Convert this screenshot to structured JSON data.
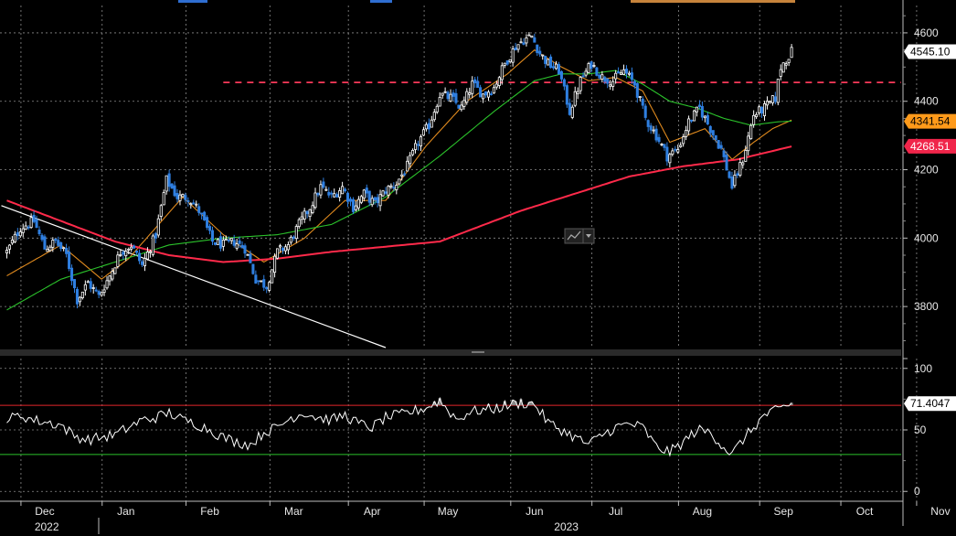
{
  "chart_data": [
    {
      "type": "candlestick",
      "panel": "price",
      "ylim": [
        3680,
        4680
      ],
      "yticks": [
        3800,
        4000,
        4200,
        4400,
        4600
      ],
      "grid": true,
      "legend": "none",
      "last_price": 4545.1,
      "last_price_label": "4545.10",
      "ma50_last": 4341.54,
      "ma50_label": "4341.54",
      "ma200_last": 4268.51,
      "ma200_label": "4268.51",
      "resistance_level": 4455,
      "colors": {
        "up": "#ffffff",
        "down": "#2f7fe0",
        "ma20": "#e08a1e",
        "ma50": "#2bc22b",
        "ma200": "#ff2a4a",
        "resistance": "#ff3a5a",
        "trendline": "#ffffff",
        "grid": "#8c8c8c",
        "badge_default": "#ffffff",
        "badge_orange": "#ff9a1a",
        "badge_red": "#f0254a"
      },
      "close_anchors": [
        [
          0,
          3960
        ],
        [
          5,
          4030
        ],
        [
          10,
          4050
        ],
        [
          14,
          3970
        ],
        [
          18,
          3990
        ],
        [
          22,
          3950
        ],
        [
          26,
          3820
        ],
        [
          30,
          3870
        ],
        [
          34,
          3830
        ],
        [
          38,
          3890
        ],
        [
          42,
          3960
        ],
        [
          46,
          3980
        ],
        [
          50,
          3920
        ],
        [
          55,
          4010
        ],
        [
          59,
          4170
        ],
        [
          63,
          4120
        ],
        [
          67,
          4120
        ],
        [
          71,
          4080
        ],
        [
          76,
          3990
        ],
        [
          80,
          3980
        ],
        [
          84,
          3990
        ],
        [
          88,
          3970
        ],
        [
          92,
          3880
        ],
        [
          96,
          3860
        ],
        [
          100,
          3960
        ],
        [
          104,
          3980
        ],
        [
          108,
          4040
        ],
        [
          112,
          4090
        ],
        [
          116,
          4150
        ],
        [
          120,
          4120
        ],
        [
          124,
          4150
        ],
        [
          128,
          4090
        ],
        [
          132,
          4130
        ],
        [
          136,
          4100
        ],
        [
          140,
          4140
        ],
        [
          144,
          4160
        ],
        [
          148,
          4210
        ],
        [
          152,
          4280
        ],
        [
          156,
          4330
        ],
        [
          160,
          4420
        ],
        [
          164,
          4410
        ],
        [
          168,
          4380
        ],
        [
          172,
          4450
        ],
        [
          176,
          4420
        ],
        [
          180,
          4440
        ],
        [
          184,
          4510
        ],
        [
          188,
          4560
        ],
        [
          191,
          4580
        ],
        [
          194,
          4590
        ],
        [
          197,
          4540
        ],
        [
          200,
          4510
        ],
        [
          204,
          4490
        ],
        [
          208,
          4370
        ],
        [
          212,
          4460
        ],
        [
          216,
          4510
        ],
        [
          220,
          4470
        ],
        [
          224,
          4460
        ],
        [
          228,
          4490
        ],
        [
          232,
          4450
        ],
        [
          236,
          4350
        ],
        [
          240,
          4300
        ],
        [
          244,
          4240
        ],
        [
          248,
          4260
        ],
        [
          252,
          4340
        ],
        [
          256,
          4380
        ],
        [
          260,
          4320
        ],
        [
          264,
          4260
        ],
        [
          268,
          4150
        ],
        [
          272,
          4230
        ],
        [
          276,
          4360
        ],
        [
          280,
          4380
        ],
        [
          284,
          4410
        ],
        [
          286,
          4500
        ],
        [
          290,
          4545
        ]
      ],
      "series": [
        {
          "name": "",
          "anchors": [
            [
              0,
              3890
            ],
            [
              20,
              3980
            ],
            [
              35,
              3880
            ],
            [
              45,
              3940
            ],
            [
              65,
              4120
            ],
            [
              80,
              4010
            ],
            [
              95,
              3930
            ],
            [
              110,
              4000
            ],
            [
              125,
              4110
            ],
            [
              140,
              4110
            ],
            [
              155,
              4270
            ],
            [
              170,
              4400
            ],
            [
              185,
              4480
            ],
            [
              195,
              4550
            ],
            [
              205,
              4500
            ],
            [
              215,
              4460
            ],
            [
              225,
              4470
            ],
            [
              235,
              4430
            ],
            [
              245,
              4280
            ],
            [
              258,
              4320
            ],
            [
              268,
              4230
            ],
            [
              276,
              4280
            ],
            [
              283,
              4320
            ],
            [
              290,
              4345
            ]
          ]
        },
        {
          "name": "",
          "anchors": [
            [
              0,
              3790
            ],
            [
              20,
              3880
            ],
            [
              40,
              3930
            ],
            [
              60,
              3980
            ],
            [
              80,
              4000
            ],
            [
              100,
              4010
            ],
            [
              120,
              4040
            ],
            [
              140,
              4120
            ],
            [
              160,
              4240
            ],
            [
              180,
              4370
            ],
            [
              195,
              4460
            ],
            [
              205,
              4480
            ],
            [
              215,
              4480
            ],
            [
              225,
              4490
            ],
            [
              235,
              4450
            ],
            [
              245,
              4400
            ],
            [
              255,
              4380
            ],
            [
              265,
              4350
            ],
            [
              275,
              4330
            ],
            [
              285,
              4340
            ],
            [
              290,
              4342
            ]
          ]
        },
        {
          "name": "",
          "anchors": [
            [
              0,
              4110
            ],
            [
              20,
              4050
            ],
            [
              40,
              3990
            ],
            [
              60,
              3950
            ],
            [
              80,
              3930
            ],
            [
              100,
              3940
            ],
            [
              120,
              3960
            ],
            [
              140,
              3975
            ],
            [
              160,
              3990
            ],
            [
              170,
              4020
            ],
            [
              190,
              4080
            ],
            [
              210,
              4130
            ],
            [
              230,
              4180
            ],
            [
              250,
              4210
            ],
            [
              270,
              4230
            ],
            [
              290,
              4268
            ]
          ]
        }
      ],
      "trendline": [
        [
          0,
          4095
        ],
        [
          140,
          3680
        ]
      ]
    },
    {
      "type": "line",
      "panel": "indicator",
      "ylim": [
        -8,
        108
      ],
      "yticks": [
        0,
        50,
        100
      ],
      "upper_band": 70,
      "lower_band": 30,
      "last_value": 71.4047,
      "last_value_label": "71.4047",
      "colors": {
        "line": "#ffffff",
        "upper_band": "#e2252b",
        "lower_band": "#2bc22b",
        "grid": "#8c8c8c"
      },
      "anchors": [
        [
          0,
          58
        ],
        [
          5,
          62
        ],
        [
          10,
          58
        ],
        [
          15,
          56
        ],
        [
          20,
          54
        ],
        [
          25,
          45
        ],
        [
          30,
          42
        ],
        [
          35,
          44
        ],
        [
          40,
          46
        ],
        [
          45,
          52
        ],
        [
          50,
          58
        ],
        [
          55,
          60
        ],
        [
          60,
          64
        ],
        [
          65,
          58
        ],
        [
          70,
          55
        ],
        [
          75,
          50
        ],
        [
          80,
          44
        ],
        [
          85,
          40
        ],
        [
          90,
          38
        ],
        [
          95,
          48
        ],
        [
          100,
          52
        ],
        [
          105,
          60
        ],
        [
          110,
          64
        ],
        [
          115,
          60
        ],
        [
          120,
          58
        ],
        [
          125,
          62
        ],
        [
          130,
          55
        ],
        [
          135,
          52
        ],
        [
          140,
          60
        ],
        [
          145,
          62
        ],
        [
          150,
          65
        ],
        [
          155,
          68
        ],
        [
          160,
          74
        ],
        [
          163,
          66
        ],
        [
          167,
          58
        ],
        [
          170,
          64
        ],
        [
          175,
          66
        ],
        [
          180,
          67
        ],
        [
          185,
          70
        ],
        [
          190,
          72
        ],
        [
          195,
          71
        ],
        [
          200,
          56
        ],
        [
          205,
          50
        ],
        [
          210,
          44
        ],
        [
          215,
          38
        ],
        [
          220,
          46
        ],
        [
          225,
          52
        ],
        [
          230,
          55
        ],
        [
          235,
          52
        ],
        [
          240,
          36
        ],
        [
          245,
          32
        ],
        [
          250,
          40
        ],
        [
          255,
          50
        ],
        [
          260,
          48
        ],
        [
          265,
          36
        ],
        [
          268,
          30
        ],
        [
          272,
          42
        ],
        [
          276,
          52
        ],
        [
          280,
          62
        ],
        [
          285,
          66
        ],
        [
          290,
          71.4
        ]
      ]
    }
  ],
  "x_axis": {
    "months": [
      {
        "label": "Dec",
        "bar": 14
      },
      {
        "label": "Jan",
        "bar": 44
      },
      {
        "label": "Feb",
        "bar": 75
      },
      {
        "label": "Mar",
        "bar": 106
      },
      {
        "label": "Apr",
        "bar": 135
      },
      {
        "label": "May",
        "bar": 163
      },
      {
        "label": "Jun",
        "bar": 195
      },
      {
        "label": "Jul",
        "bar": 225
      },
      {
        "label": "Aug",
        "bar": 257
      },
      {
        "label": "Sep",
        "bar": 287
      },
      {
        "label": "Oct",
        "bar": 317
      },
      {
        "label": "Nov",
        "bar": 345
      }
    ],
    "years": [
      {
        "label": "2022",
        "bar": 8
      },
      {
        "label": "2023",
        "bar": 200
      }
    ],
    "bars_total": 291
  }
}
